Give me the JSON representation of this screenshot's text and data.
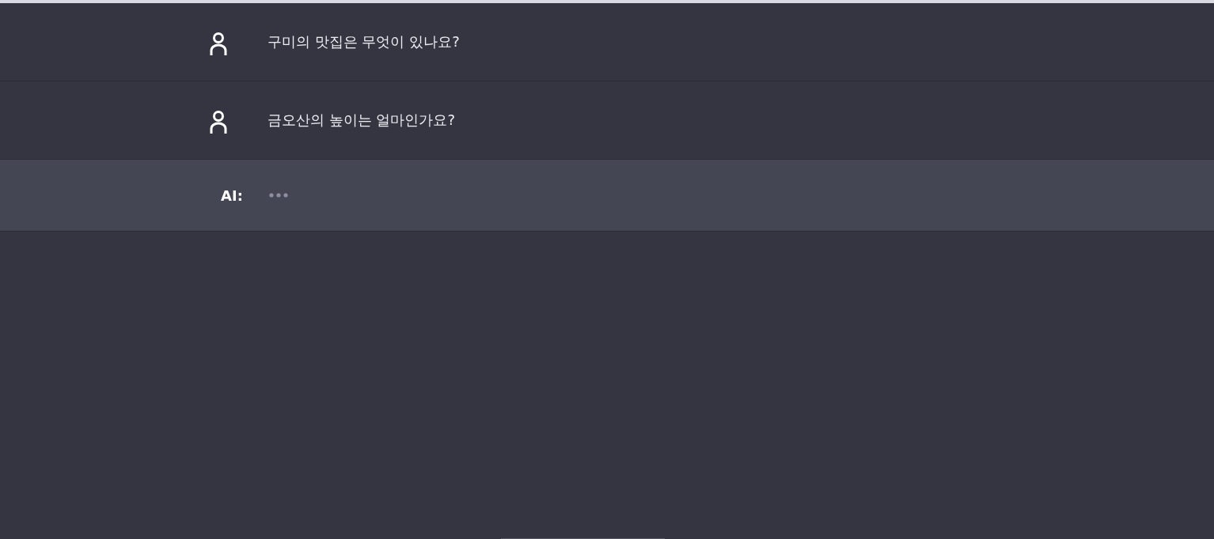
{
  "messages": [
    {
      "kind": "user",
      "text": "구미의 맛집은 무엇이 있나요?"
    },
    {
      "kind": "user",
      "text": "금오산의 높이는 얼마인가요?"
    },
    {
      "kind": "ai",
      "label": "AI:",
      "typing": true
    }
  ]
}
